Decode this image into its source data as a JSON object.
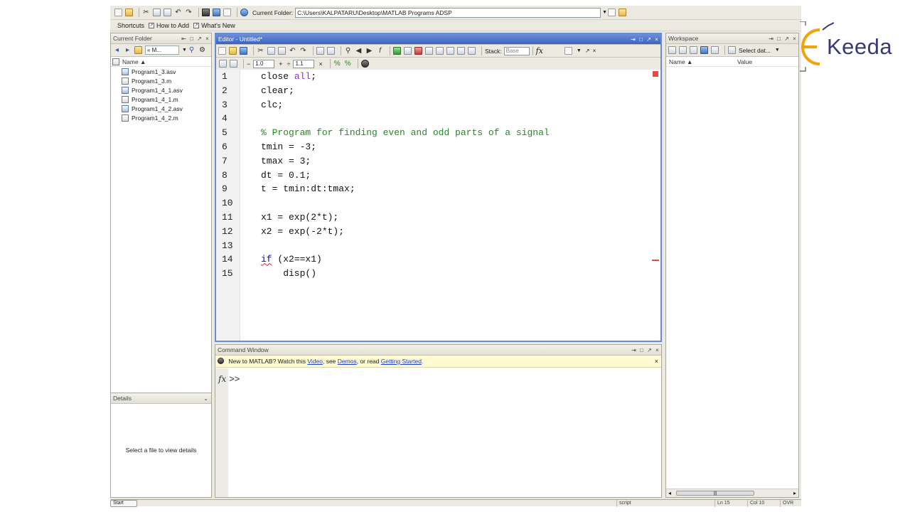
{
  "toolbar": {
    "current_folder_label": "Current Folder:",
    "current_folder_path": "C:\\Users\\KALPATARU\\Desktop\\MATLAB Programs ADSP"
  },
  "shortcuts": {
    "items": [
      "Shortcuts",
      "How to Add",
      "What's New"
    ]
  },
  "current_folder": {
    "title": "Current Folder",
    "path_short": "« M...",
    "column_name": "Name ▲",
    "files": [
      {
        "name": "Program1_3.asv",
        "kind": "asv"
      },
      {
        "name": "Program1_3.m",
        "kind": "m"
      },
      {
        "name": "Program1_4_1.asv",
        "kind": "asv"
      },
      {
        "name": "Program1_4_1.m",
        "kind": "m"
      },
      {
        "name": "Program1_4_2.asv",
        "kind": "asv"
      },
      {
        "name": "Program1_4_2.m",
        "kind": "m"
      }
    ]
  },
  "details": {
    "title": "Details",
    "empty_text": "Select a file to view details"
  },
  "editor": {
    "title": "Editor - Untitled*",
    "stack_label": "Stack:",
    "stack_value": "Base",
    "cell_step_1": "1.0",
    "cell_step_2": "1.1",
    "line_numbers": [
      "1",
      "2",
      "3",
      "4",
      "5",
      "6",
      "7",
      "8",
      "9",
      "10",
      "11",
      "12",
      "13",
      "14",
      "15"
    ],
    "lines": {
      "l1_kw": "close ",
      "l1_str": "all",
      "l1_rest": ";",
      "l2": "clear;",
      "l3": "clc;",
      "l5_cmt": "% Program for finding even and odd parts of a signal",
      "l6": "tmin = -3;",
      "l7": "tmax = 3;",
      "l8": "dt = 0.1;",
      "l9": "t = tmin:dt:tmax;",
      "l11": "x1 = exp(2*t);",
      "l12": "x2 = exp(-2*t);",
      "l14_kw": "if",
      "l14_rest": " (x2==x1)",
      "l15": "    disp()"
    }
  },
  "command_window": {
    "title": "Command Window",
    "note_prefix": "New to MATLAB? Watch this ",
    "note_video": "Video",
    "note_mid": ", see ",
    "note_demos": "Demos",
    "note_mid2": ", or read ",
    "note_getting_started": "Getting Started",
    "note_suffix": ".",
    "prompt": ">>"
  },
  "workspace": {
    "title": "Workspace",
    "select_data": "Select dat...",
    "col_name": "Name ▲",
    "col_value": "Value"
  },
  "status_bar": {
    "start": "Start",
    "mode": "script",
    "ln_label": "Ln",
    "ln": "15",
    "col_label": "Col",
    "col": "10",
    "ovr": "OVR"
  },
  "logo": {
    "text": "Keeda",
    "accent": "#f2a20a",
    "color": "#3a3a73"
  }
}
